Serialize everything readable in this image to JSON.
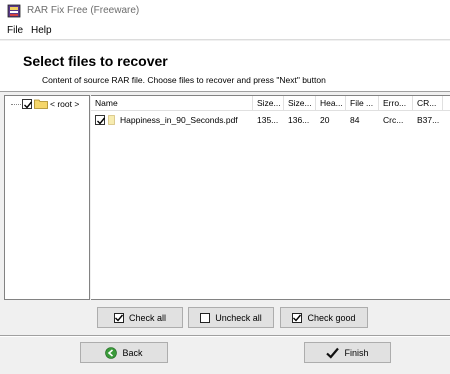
{
  "window": {
    "title": "RAR Fix Free (Freeware)",
    "icon": "rar-archive-icon"
  },
  "menu": [
    {
      "label": "File"
    },
    {
      "label": "Help"
    }
  ],
  "header": {
    "title": "Select files to recover",
    "subtitle": "Content of source RAR file. Choose files to recover and press \"Next\" button"
  },
  "tree": {
    "root_label": "< root >",
    "checked": true
  },
  "table": {
    "columns": [
      "Name",
      "Size...",
      "Size...",
      "Hea...",
      "File ...",
      "Erro...",
      "CR..."
    ],
    "rows": [
      {
        "checked": true,
        "name": "Happiness_in_90_Seconds.pdf",
        "size1": "135...",
        "size2": "136...",
        "header": "20",
        "file": "84",
        "error": "Crc...",
        "crc": "B37..."
      }
    ]
  },
  "tools": {
    "check_all": "Check all",
    "uncheck_all": "Uncheck all",
    "check_good": "Check good"
  },
  "nav": {
    "back": "Back",
    "finish": "Finish"
  },
  "colors": {
    "back_arrow": "#3a9a3a",
    "finish_check": "#111111"
  }
}
